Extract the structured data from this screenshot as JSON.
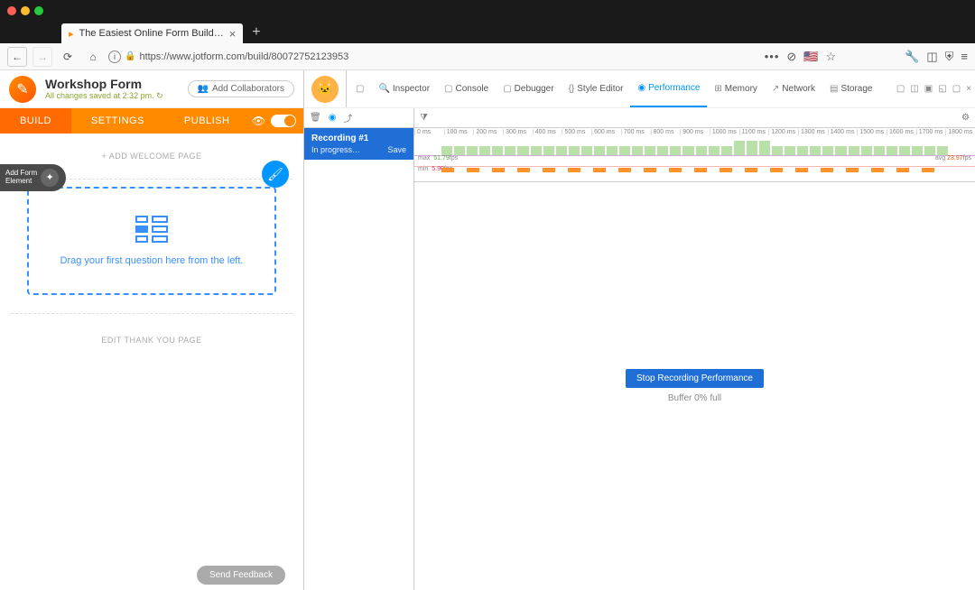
{
  "browser": {
    "tab_title": "The Easiest Online Form Build…",
    "url": "https://www.jotform.com/build/80072752123953"
  },
  "jotform": {
    "title": "Workshop Form",
    "saved_text": "All changes saved at 2:32 pm.",
    "collaborators": "Add Collaborators",
    "tabs": {
      "build": "BUILD",
      "settings": "SETTINGS",
      "publish": "PUBLISH"
    },
    "add_element": "Add Form Element",
    "welcome": "+ ADD WELCOME PAGE",
    "drop_text": "Drag your first question here from the left.",
    "thank": "EDIT THANK YOU PAGE",
    "feedback": "Send Feedback"
  },
  "devtools": {
    "tabs": {
      "inspector": "Inspector",
      "console": "Console",
      "debugger": "Debugger",
      "style": "Style Editor",
      "performance": "Performance",
      "memory": "Memory",
      "network": "Network",
      "storage": "Storage"
    },
    "recording": {
      "title": "Recording #1",
      "status": "In progress…",
      "save": "Save"
    },
    "timeline": {
      "ticks": [
        "0 ms",
        "100 ms",
        "200 ms",
        "300 ms",
        "400 ms",
        "500 ms",
        "600 ms",
        "700 ms",
        "800 ms",
        "900 ms",
        "1000 ms",
        "1100 ms",
        "1200 ms",
        "1300 ms",
        "1400 ms",
        "1500 ms",
        "1600 ms",
        "1700 ms",
        "1800 ms"
      ],
      "fps_max_label": "max",
      "fps_max": "51.79",
      "fps_min_label": "min",
      "fps_min": "5.90",
      "fps_unit": "fps",
      "avg_label": "avg",
      "avg_value": "23.97"
    },
    "stop_button": "Stop Recording Performance",
    "buffer": "Buffer 0% full"
  }
}
